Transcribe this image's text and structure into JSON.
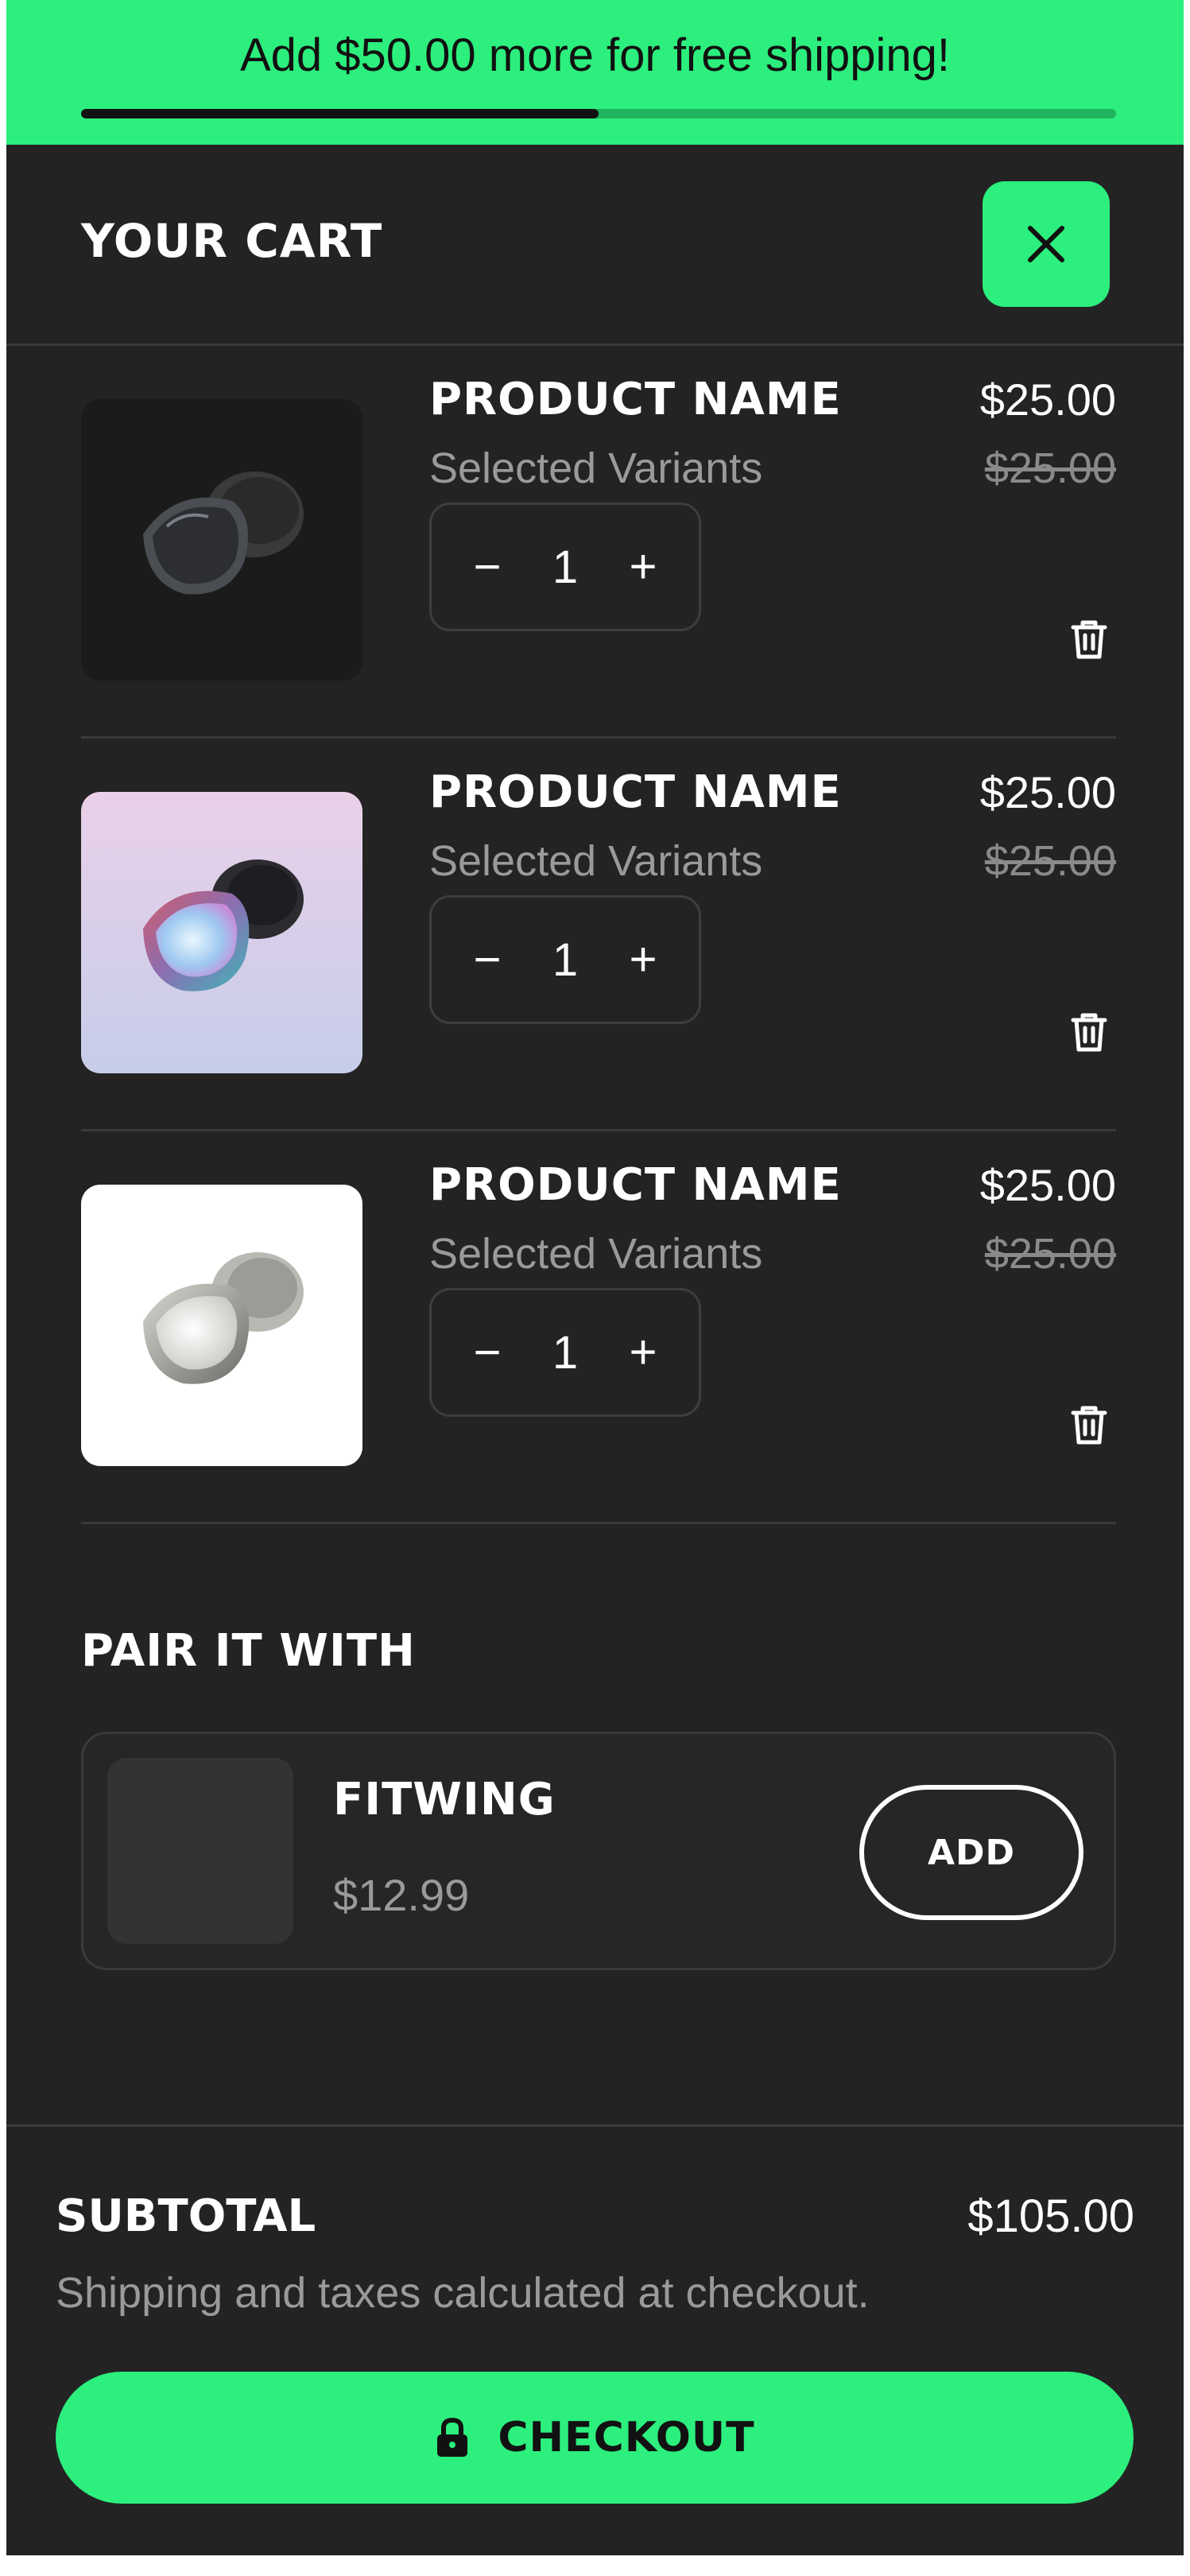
{
  "banner": {
    "text": "Add $50.00 more for free shipping!",
    "progress_percent": 50
  },
  "header": {
    "title": "YOUR CART",
    "close_icon": "close-icon"
  },
  "items": [
    {
      "name": "PRODUCT NAME",
      "variant": "Selected Variants",
      "price": "$25.00",
      "compare_price": "$25.00",
      "quantity": "1",
      "minus": "−",
      "plus": "+",
      "image": "black-earbud-image",
      "image_bg": "#1b1b1b"
    },
    {
      "name": "PRODUCT NAME",
      "variant": "Selected Variants",
      "price": "$25.00",
      "compare_price": "$25.00",
      "quantity": "1",
      "minus": "−",
      "plus": "+",
      "image": "iridescent-earbud-image",
      "image_bg": "#e7cfe6"
    },
    {
      "name": "PRODUCT NAME",
      "variant": "Selected Variants",
      "price": "$25.00",
      "compare_price": "$25.00",
      "quantity": "1",
      "minus": "−",
      "plus": "+",
      "image": "silver-earbud-image",
      "image_bg": "#ffffff"
    }
  ],
  "pair": {
    "title": "PAIR IT WITH",
    "product_name": "FITWING",
    "product_price": "$12.99",
    "add_label": "ADD"
  },
  "footer": {
    "subtotal_label": "SUBTOTAL",
    "subtotal_value": "$105.00",
    "shipping_note": "Shipping and taxes calculated at checkout.",
    "checkout_label": "CHECKOUT",
    "checkout_icon": "lock-icon"
  },
  "colors": {
    "accent": "#2cef7d",
    "background": "#232323",
    "muted_text": "#9a9a9a"
  }
}
